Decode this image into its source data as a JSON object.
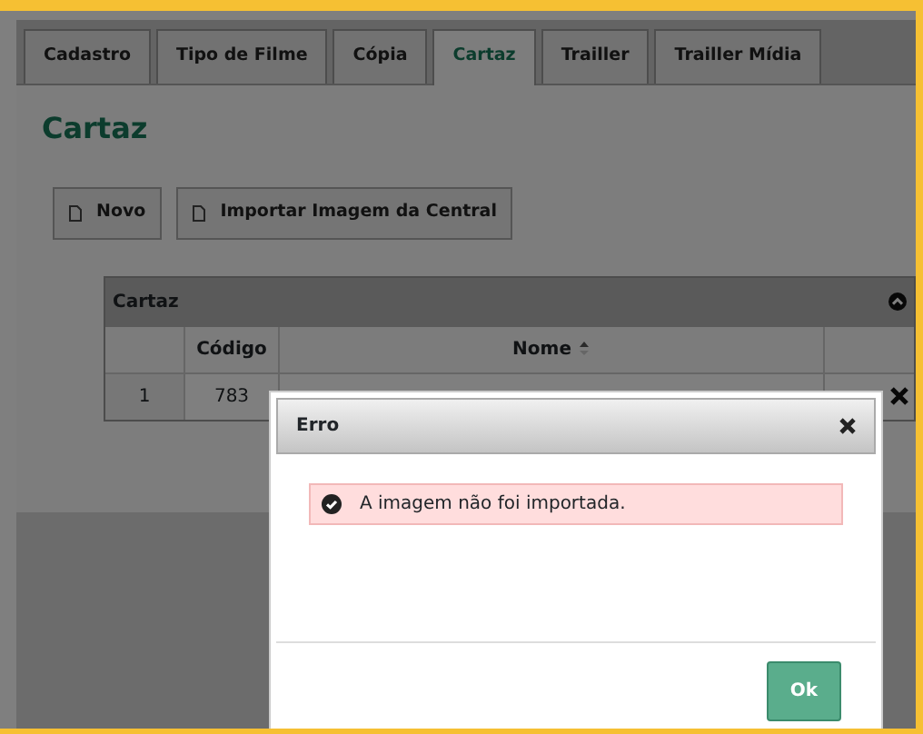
{
  "tabs": [
    {
      "label": "Cadastro",
      "selected": false
    },
    {
      "label": "Tipo de Filme",
      "selected": false
    },
    {
      "label": "Cópia",
      "selected": false
    },
    {
      "label": "Cartaz",
      "selected": true
    },
    {
      "label": "Trailler",
      "selected": false
    },
    {
      "label": "Trailler Mídia",
      "selected": false
    }
  ],
  "page_title": "Cartaz",
  "buttons": [
    "Novo",
    "Importar Imagem da Central"
  ],
  "table": {
    "title": "Cartaz",
    "columns": [
      "",
      "Código",
      "Nome"
    ],
    "rows": [
      {
        "cells": [
          "1",
          "783"
        ]
      }
    ]
  },
  "dialog": {
    "title": "Erro",
    "message": "A imagem não foi importada.",
    "button": "Ok"
  }
}
